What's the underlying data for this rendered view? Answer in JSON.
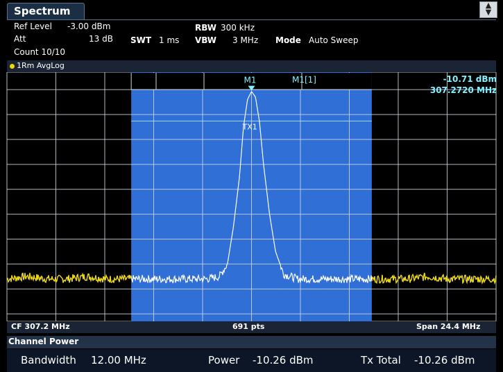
{
  "window": {
    "title": "Spectrum",
    "corner_icon": "expand-arrows-icon"
  },
  "header": {
    "ref_level_label": "Ref Level",
    "ref_level_value": "-3.00 dBm",
    "att_label": "Att",
    "att_value": "13 dB",
    "swt_label": "SWT",
    "swt_value": "1 ms",
    "rbw_label": "RBW",
    "rbw_value": "300 kHz",
    "vbw_label": "VBW",
    "vbw_value": "3 MHz",
    "mode_label": "Mode",
    "mode_value": "Auto Sweep",
    "count": "Count 10/10"
  },
  "trace": {
    "label": "1Rm AvgLog",
    "color": "#f0d800"
  },
  "marker": {
    "name": "M1",
    "readout_label": "M1[1]",
    "level": "-10.71 dBm",
    "freq": "307.2720 MHz",
    "channel_label": "TX1"
  },
  "axis": {
    "y_ticks": [
      "-10 dBm",
      "-20 dBm",
      "-30 dBm",
      "-40 dBm",
      "-50 dBm",
      "-60 dBm",
      "-70 dBm",
      "-80 dBm",
      "-90 dBm",
      "-100 dBm"
    ]
  },
  "footer": {
    "cf": "CF 307.2 MHz",
    "points": "691 pts",
    "span": "Span 24.4 MHz"
  },
  "channel_power": {
    "title": "Channel Power",
    "bandwidth_label": "Bandwidth",
    "bandwidth_value": "12.00 MHz",
    "power_label": "Power",
    "power_value": "-10.26 dBm",
    "txtotal_label": "Tx Total",
    "txtotal_value": "-10.26 dBm"
  },
  "chart_data": {
    "type": "line",
    "ylim": [
      -103,
      -3
    ],
    "xlim": [
      295.0,
      319.4
    ],
    "channel_band": [
      301.2,
      313.2
    ],
    "grid": true,
    "series": [
      {
        "color": "#f0d800",
        "x": [
          295.0,
          296.0,
          297.0,
          298.0,
          299.0,
          300.0,
          301.0,
          302.0,
          303.0,
          304.0,
          305.0,
          305.6,
          306.0,
          306.3,
          306.6,
          306.8,
          307.0,
          307.2,
          307.4,
          307.6,
          307.8,
          308.1,
          308.4,
          308.8,
          309.5,
          310.0,
          311.0,
          312.0,
          313.0,
          314.0,
          315.0,
          316.0,
          317.0,
          318.0,
          319.4
        ],
        "y": [
          -86,
          -85,
          -86,
          -86,
          -85,
          -86,
          -86,
          -86,
          -86,
          -86,
          -86,
          -85,
          -80,
          -65,
          -45,
          -25,
          -14,
          -10.7,
          -13,
          -23,
          -40,
          -60,
          -75,
          -84,
          -86,
          -86,
          -86,
          -86,
          -86,
          -86,
          -86,
          -85,
          -86,
          -86,
          -86
        ]
      }
    ]
  }
}
